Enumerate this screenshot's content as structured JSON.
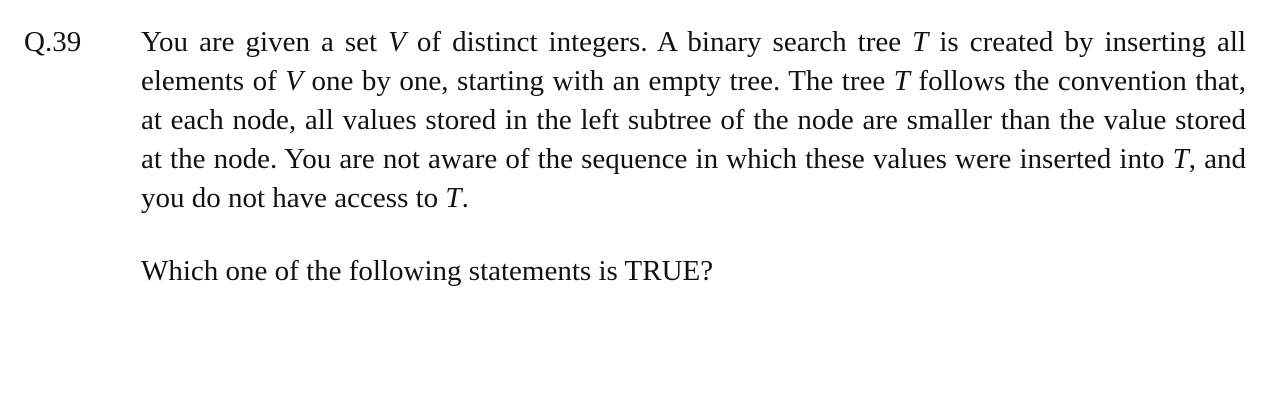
{
  "question": {
    "number": "Q.39",
    "stem": {
      "s1": "You are given a set ",
      "v1": "V",
      "s2": " of distinct integers. A binary search tree ",
      "t1": "T",
      "s3": " is created by inserting all elements of ",
      "v2": "V",
      "s4": " one by one, starting with an empty tree. The tree ",
      "t2": "T",
      "s5": " follows the convention that, at each node, all values stored in the left subtree of the node are smaller than the value stored at the node. You are not aware of the sequence in which these values were inserted into ",
      "t3": "T",
      "s6": ", and you do not have access to ",
      "t4": "T",
      "s7": "."
    },
    "prompt": "Which one of the following statements is TRUE?"
  }
}
